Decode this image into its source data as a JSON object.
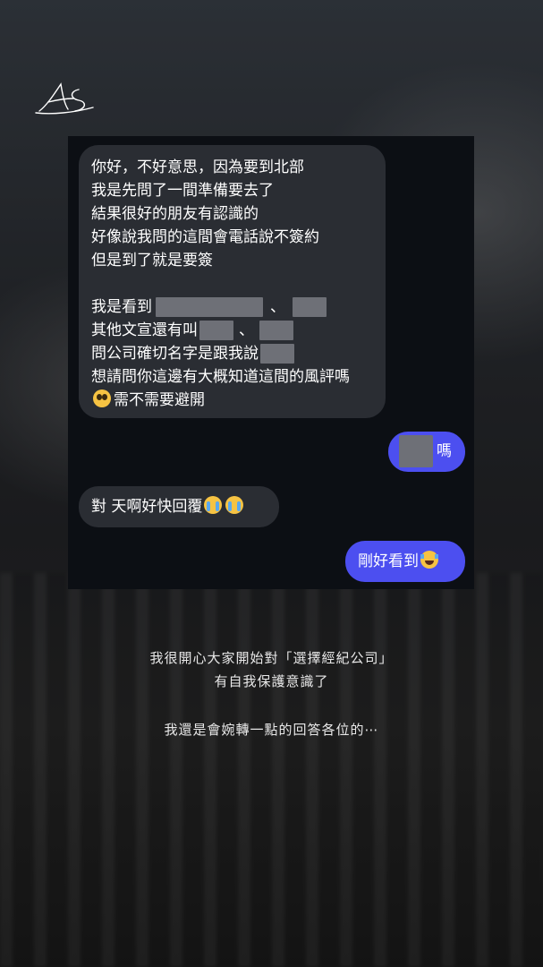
{
  "chat": {
    "message1": {
      "lines": [
        "你好，不好意思，因為要到北部",
        "我是先問了一間準備要去了",
        "結果很好的朋友有認識的",
        "好像說我問的這間會電話說不簽約",
        "但是到了就是要簽"
      ],
      "line6_prefix": "我是看到",
      "line6_sep": "、",
      "line7_prefix": "其他文宣還有叫",
      "line7_sep": "、",
      "line8_prefix": "問公司確切名字是跟我說",
      "line9": "想請問你這邊有大概知道這間的風評嗎",
      "line10": "需不需要避開",
      "line10_emoji": "pleading-face-icon"
    },
    "message2": {
      "text": "嗎"
    },
    "message3": {
      "text": "對 天啊好快回覆",
      "emoji": "loudly-crying-face-icon"
    },
    "message4": {
      "text": "剛好看到",
      "emoji": "tears-of-joy-icon"
    }
  },
  "caption": {
    "line1": "我很開心大家開始對「選擇經紀公司」",
    "line2": "有自我保護意識了",
    "line3": "我還是會婉轉一點的回答各位的⋯"
  },
  "colors": {
    "incoming_bubble": "#2a2d33",
    "outgoing_bubble": "#4c4ff0",
    "chat_bg": "#0c0f14",
    "redaction": "#6e7077"
  }
}
